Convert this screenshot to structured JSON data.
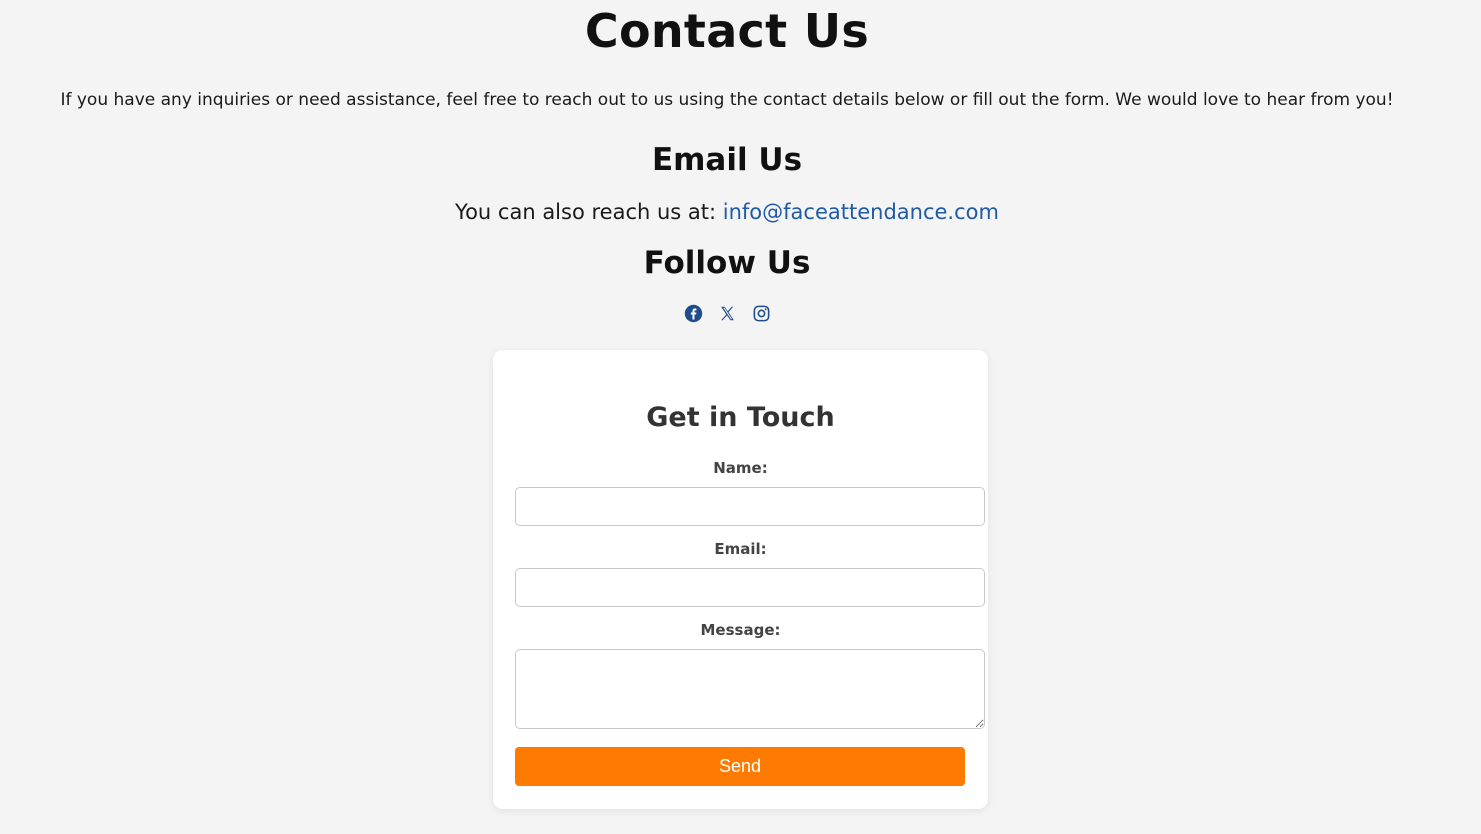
{
  "header": {
    "title": "Contact Us",
    "intro": "If you have any inquiries or need assistance, feel free to reach out to us using the contact details below or fill out the form. We would love to hear from you!"
  },
  "email_section": {
    "heading": "Email Us",
    "prefix": "You can also reach us at: ",
    "address": "info@faceattendance.com"
  },
  "follow_section": {
    "heading": "Follow Us",
    "icons": [
      "facebook-icon",
      "x-twitter-icon",
      "instagram-icon"
    ]
  },
  "form": {
    "title": "Get in Touch",
    "name_label": "Name:",
    "name_value": "",
    "email_label": "Email:",
    "email_value": "",
    "message_label": "Message:",
    "message_value": "",
    "submit_label": "Send"
  },
  "colors": {
    "background": "#f4f4f4",
    "link": "#1f5aa6",
    "button": "#ff7a00"
  }
}
